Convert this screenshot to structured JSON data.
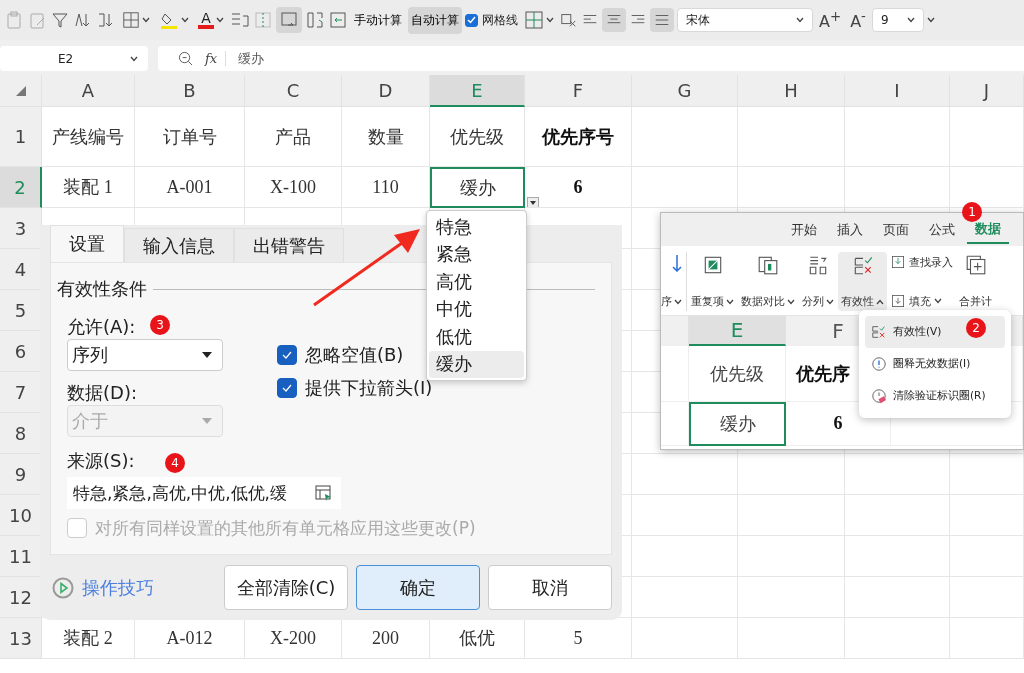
{
  "toolbar": {
    "calc_buttons": [
      {
        "label": "手动计算",
        "selected": false
      },
      {
        "label": "自动计算",
        "selected": true
      }
    ],
    "gridlines": {
      "label": "网格线",
      "checked": true
    },
    "font_color_glyph": "A",
    "font_name": "宋体",
    "font_size": "9",
    "grow_font": "A$^{+}$",
    "shrink_font": "A$^{-}$"
  },
  "formula_bar": {
    "cell_ref": "E2",
    "fx": "fx",
    "value": "缓办"
  },
  "sheet": {
    "columns": [
      {
        "label": "A",
        "selected": false
      },
      {
        "label": "B",
        "selected": false
      },
      {
        "label": "C",
        "selected": false
      },
      {
        "label": "D",
        "selected": false
      },
      {
        "label": "E",
        "selected": true
      },
      {
        "label": "F",
        "selected": false
      },
      {
        "label": "G",
        "selected": false
      },
      {
        "label": "H",
        "selected": false
      },
      {
        "label": "I",
        "selected": false
      },
      {
        "label": "J",
        "selected": false
      }
    ],
    "rows": [
      {
        "label": "1",
        "selected": false,
        "cells": [
          {
            "text": "产线编号"
          },
          {
            "text": "订单号"
          },
          {
            "text": "产品"
          },
          {
            "text": "数量"
          },
          {
            "text": "优先级"
          },
          {
            "text": "优先序号",
            "bold": true
          }
        ]
      },
      {
        "label": "2",
        "selected": true,
        "cells": [
          {
            "text": "装配 1"
          },
          {
            "text": "A-001"
          },
          {
            "text": "X-100"
          },
          {
            "text": "110"
          },
          {
            "text": "缓办"
          },
          {
            "text": "6",
            "bold": true
          }
        ]
      },
      {
        "label": "3",
        "selected": false
      },
      {
        "label": "4",
        "selected": false
      },
      {
        "label": "5",
        "selected": false
      },
      {
        "label": "6",
        "selected": false
      },
      {
        "label": "7",
        "selected": false
      },
      {
        "label": "8",
        "selected": false
      },
      {
        "label": "9",
        "selected": false
      },
      {
        "label": "10",
        "selected": false
      },
      {
        "label": "11",
        "selected": false
      },
      {
        "label": "12",
        "selected": false
      },
      {
        "label": "13",
        "selected": false,
        "cells": [
          {
            "text": "装配 2"
          },
          {
            "text": "A-012"
          },
          {
            "text": "X-200"
          },
          {
            "text": "200"
          },
          {
            "text": "低优"
          },
          {
            "text": "5"
          }
        ]
      }
    ]
  },
  "dropdown_list": {
    "items": [
      {
        "label": "特急",
        "selected": false
      },
      {
        "label": "紧急",
        "selected": false
      },
      {
        "label": "高优",
        "selected": false
      },
      {
        "label": "中优",
        "selected": false
      },
      {
        "label": "低优",
        "selected": false
      },
      {
        "label": "缓办",
        "selected": true
      }
    ]
  },
  "validation_dialog": {
    "tabs": [
      {
        "label": "设置",
        "selected": true
      },
      {
        "label": "输入信息",
        "selected": false
      },
      {
        "label": "出错警告",
        "selected": false
      }
    ],
    "section_title": "有效性条件",
    "allow": {
      "label": "允许(A):",
      "value": "序列",
      "disabled": false
    },
    "data": {
      "label": "数据(D):",
      "value": "介于",
      "disabled": true
    },
    "source": {
      "label": "来源(S):",
      "value": "特急,紧急,高优,中优,低优,缓"
    },
    "options": [
      {
        "label": "忽略空值(B)",
        "checked": true
      },
      {
        "label": "提供下拉箭头(I)",
        "checked": true
      }
    ],
    "apply_all": {
      "label": "对所有同样设置的其他所有单元格应用这些更改(P)",
      "checked": false,
      "disabled": true
    },
    "tips_link": "操作技巧",
    "buttons": [
      {
        "label": "全部清除(C)",
        "kind": "normal"
      },
      {
        "label": "确定",
        "kind": "primary"
      },
      {
        "label": "取消",
        "kind": "normal"
      }
    ]
  },
  "inset": {
    "tabs": [
      {
        "label": "开始",
        "selected": false
      },
      {
        "label": "插入",
        "selected": false
      },
      {
        "label": "页面",
        "selected": false
      },
      {
        "label": "公式",
        "selected": false
      },
      {
        "label": "数据",
        "selected": true
      }
    ],
    "ribbon": [
      {
        "label": "序",
        "kind": "large",
        "dropdown": true,
        "expanded": false
      },
      {
        "label": "重复项",
        "kind": "large",
        "dropdown": true,
        "expanded": false
      },
      {
        "label": "数据对比",
        "kind": "large",
        "dropdown": true,
        "expanded": false
      },
      {
        "label": "分列",
        "kind": "large",
        "dropdown": true,
        "expanded": false
      },
      {
        "label": "有效性",
        "kind": "large",
        "dropdown": true,
        "expanded": true
      },
      {
        "label": "查找录入",
        "kind": "small",
        "dropdown": false,
        "expanded": false
      },
      {
        "label": "填充",
        "kind": "small",
        "dropdown": true,
        "expanded": false
      },
      {
        "label": "合并计",
        "kind": "large",
        "dropdown": false,
        "expanded": false
      }
    ],
    "menu": [
      {
        "label": "有效性(V)",
        "selected": true
      },
      {
        "label": "圈释无效数据(I)",
        "selected": false
      },
      {
        "label": "清除验证标识圈(R)",
        "selected": false
      }
    ],
    "columns": [
      {
        "label": "E",
        "selected": true
      },
      {
        "label": "F",
        "selected": false
      }
    ],
    "rows": [
      {
        "selected": false,
        "cells": [
          {
            "text": "优先级"
          },
          {
            "text": "优先序",
            "bold": true
          }
        ]
      },
      {
        "selected": true,
        "cells": [
          {
            "text": "缓办"
          },
          {
            "text": "6",
            "bold": true
          }
        ]
      }
    ]
  },
  "badges": [
    {
      "label": "1"
    },
    {
      "label": "2"
    },
    {
      "label": "3"
    },
    {
      "label": "4"
    }
  ]
}
